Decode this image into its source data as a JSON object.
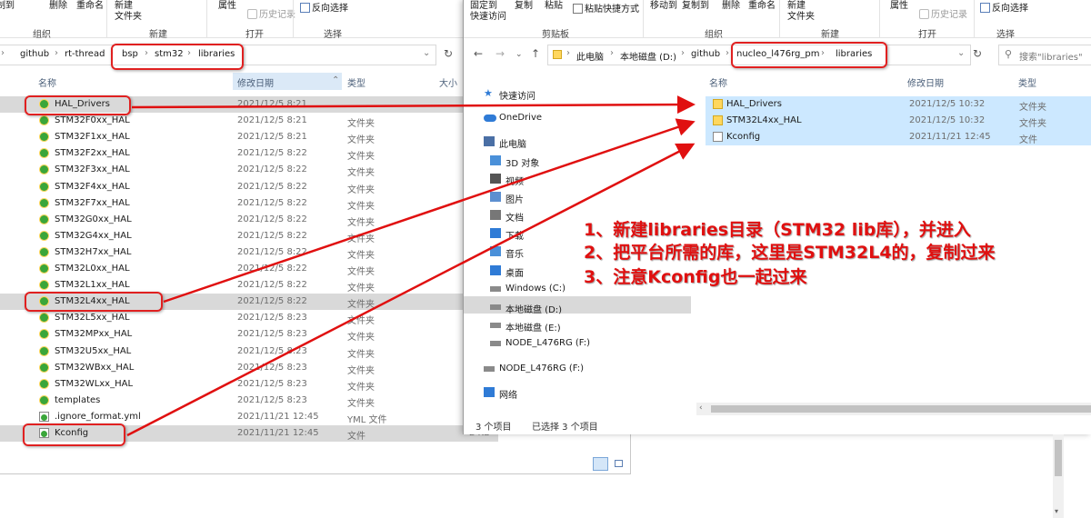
{
  "left": {
    "ribbon": {
      "copy_to": "复制到",
      "delete": "删除",
      "rename": "重命名",
      "new_folder_l1": "新建",
      "new_folder_l2": "文件夹",
      "properties": "属性",
      "history": "历史记录",
      "invert": "反向选择",
      "group_organize": "组织",
      "group_new": "新建",
      "group_open": "打开",
      "group_select": "选择"
    },
    "breadcrumb": [
      "github",
      "rt-thread",
      "bsp",
      "stm32",
      "libraries"
    ],
    "columns": {
      "name": "名称",
      "date": "修改日期",
      "type": "类型",
      "size": "大小"
    },
    "files": [
      {
        "name": "HAL_Drivers",
        "date": "2021/12/5 8:21",
        "type": "",
        "kind": "folder"
      },
      {
        "name": "STM32F0xx_HAL",
        "date": "2021/12/5 8:21",
        "type": "文件夹",
        "kind": "folder"
      },
      {
        "name": "STM32F1xx_HAL",
        "date": "2021/12/5 8:21",
        "type": "文件夹",
        "kind": "folder"
      },
      {
        "name": "STM32F2xx_HAL",
        "date": "2021/12/5 8:22",
        "type": "文件夹",
        "kind": "folder"
      },
      {
        "name": "STM32F3xx_HAL",
        "date": "2021/12/5 8:22",
        "type": "文件夹",
        "kind": "folder"
      },
      {
        "name": "STM32F4xx_HAL",
        "date": "2021/12/5 8:22",
        "type": "文件夹",
        "kind": "folder"
      },
      {
        "name": "STM32F7xx_HAL",
        "date": "2021/12/5 8:22",
        "type": "文件夹",
        "kind": "folder"
      },
      {
        "name": "STM32G0xx_HAL",
        "date": "2021/12/5 8:22",
        "type": "文件夹",
        "kind": "folder"
      },
      {
        "name": "STM32G4xx_HAL",
        "date": "2021/12/5 8:22",
        "type": "文件夹",
        "kind": "folder"
      },
      {
        "name": "STM32H7xx_HAL",
        "date": "2021/12/5 8:22",
        "type": "文件夹",
        "kind": "folder"
      },
      {
        "name": "STM32L0xx_HAL",
        "date": "2021/12/5 8:22",
        "type": "文件夹",
        "kind": "folder"
      },
      {
        "name": "STM32L1xx_HAL",
        "date": "2021/12/5 8:22",
        "type": "文件夹",
        "kind": "folder"
      },
      {
        "name": "STM32L4xx_HAL",
        "date": "2021/12/5 8:22",
        "type": "文件夹",
        "kind": "folder"
      },
      {
        "name": "STM32L5xx_HAL",
        "date": "2021/12/5 8:23",
        "type": "文件夹",
        "kind": "folder"
      },
      {
        "name": "STM32MPxx_HAL",
        "date": "2021/12/5 8:23",
        "type": "文件夹",
        "kind": "folder"
      },
      {
        "name": "STM32U5xx_HAL",
        "date": "2021/12/5 8:23",
        "type": "文件夹",
        "kind": "folder"
      },
      {
        "name": "STM32WBxx_HAL",
        "date": "2021/12/5 8:23",
        "type": "文件夹",
        "kind": "folder"
      },
      {
        "name": "STM32WLxx_HAL",
        "date": "2021/12/5 8:23",
        "type": "文件夹",
        "kind": "folder"
      },
      {
        "name": "templates",
        "date": "2021/12/5 8:23",
        "type": "文件夹",
        "kind": "folder"
      },
      {
        "name": ".ignore_format.yml",
        "date": "2021/11/21 12:45",
        "type": "YML 文件",
        "kind": "file"
      },
      {
        "name": "Kconfig",
        "date": "2021/11/21 12:45",
        "type": "文件",
        "size": "2 KB",
        "kind": "file"
      }
    ]
  },
  "right": {
    "ribbon": {
      "pin_l1": "固定到",
      "pin_l2": "快速访问",
      "copy": "复制",
      "paste": "粘贴",
      "paste_shortcut": "粘贴快捷方式",
      "move_to": "移动到",
      "copy_to": "复制到",
      "delete": "删除",
      "rename": "重命名",
      "new_folder_l1": "新建",
      "new_folder_l2": "文件夹",
      "properties": "属性",
      "history": "历史记录",
      "invert": "反向选择",
      "group_clipboard": "剪贴板",
      "group_organize": "组织",
      "group_new": "新建",
      "group_open": "打开",
      "group_select": "选择"
    },
    "breadcrumb": [
      "此电脑",
      "本地磁盘 (D:)",
      "github",
      "nucleo_l476rg_pm",
      "libraries"
    ],
    "search_placeholder": "搜索\"libraries\"",
    "columns": {
      "name": "名称",
      "date": "修改日期",
      "type": "类型"
    },
    "nav": [
      {
        "label": "快速访问",
        "icon": "star-icon"
      },
      {
        "label": "OneDrive",
        "icon": "cloud-icon"
      },
      {
        "label": "此电脑",
        "icon": "pc-icon"
      },
      {
        "label": "3D 对象",
        "icon": "cube-icon"
      },
      {
        "label": "视频",
        "icon": "video-icon"
      },
      {
        "label": "图片",
        "icon": "image-icon"
      },
      {
        "label": "文档",
        "icon": "document-icon"
      },
      {
        "label": "下载",
        "icon": "download-icon"
      },
      {
        "label": "音乐",
        "icon": "music-icon"
      },
      {
        "label": "桌面",
        "icon": "desktop-icon"
      },
      {
        "label": "Windows (C:)",
        "icon": "drive-icon"
      },
      {
        "label": "本地磁盘 (D:)",
        "icon": "drive-icon"
      },
      {
        "label": "本地磁盘 (E:)",
        "icon": "drive-icon"
      },
      {
        "label": "NODE_L476RG (F:)",
        "icon": "drive-icon"
      },
      {
        "label": "NODE_L476RG (F:)",
        "icon": "drive-icon"
      },
      {
        "label": "网络",
        "icon": "network-icon"
      }
    ],
    "files": [
      {
        "name": "HAL_Drivers",
        "date": "2021/12/5 10:32",
        "type": "文件夹",
        "kind": "folder"
      },
      {
        "name": "STM32L4xx_HAL",
        "date": "2021/12/5 10:32",
        "type": "文件夹",
        "kind": "folder"
      },
      {
        "name": "Kconfig",
        "date": "2021/11/21 12:45",
        "type": "文件",
        "kind": "file"
      }
    ],
    "status_count": "3 个项目",
    "status_selected": "已选择 3 个项目"
  },
  "annotations": {
    "line1": "1、新建libraries目录（STM32 lib库），并进入",
    "line2": "2、把平台所需的库，这里是STM32L4的，复制过来",
    "line3": "3、注意Kconfig也一起过来"
  },
  "colors": {
    "annotation": "#e01010",
    "selection": "#cce8ff",
    "folder": "#ffd75e"
  }
}
